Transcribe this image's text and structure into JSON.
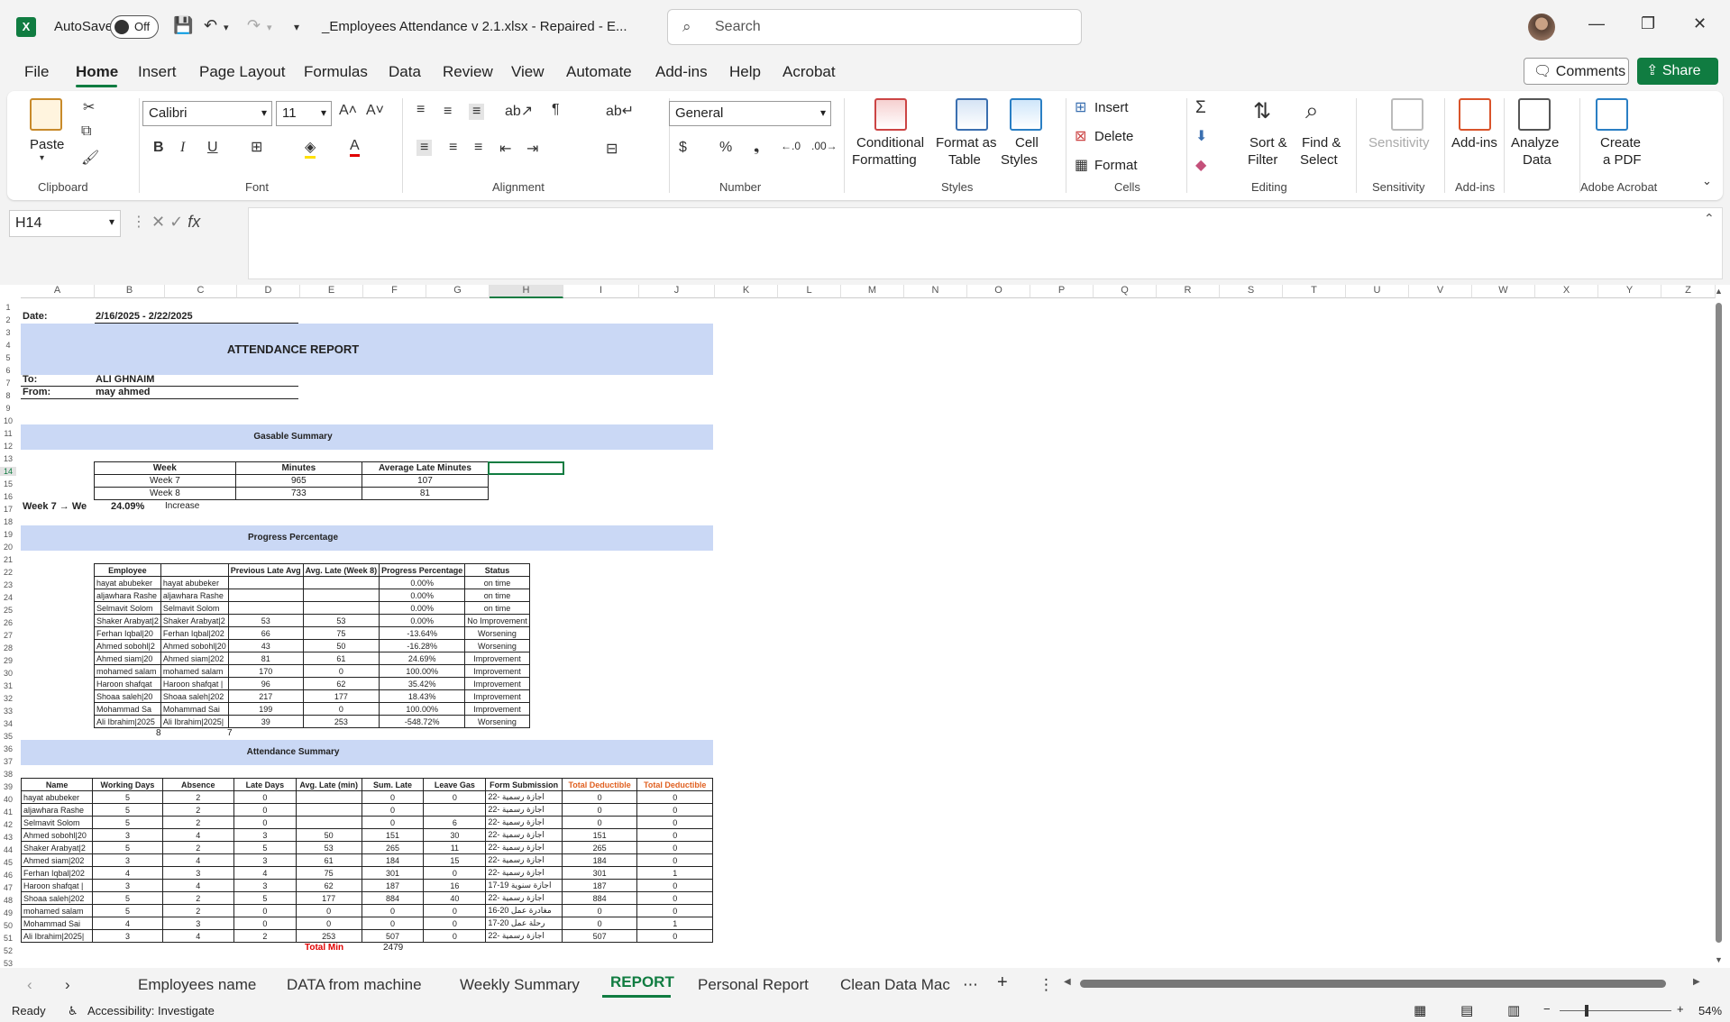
{
  "titlebar": {
    "autosave_label": "AutoSave",
    "autosave_state": "Off",
    "doc_title": "_Employees Attendance  v 2.1.xlsx  -  Repaired  -  E...",
    "search_placeholder": "Search"
  },
  "menu": {
    "items": [
      "File",
      "Home",
      "Insert",
      "Page Layout",
      "Formulas",
      "Data",
      "Review",
      "View",
      "Automate",
      "Add-ins",
      "Help",
      "Acrobat"
    ],
    "comments": "Comments",
    "share": "Share"
  },
  "ribbon": {
    "clipboard": {
      "paste": "Paste",
      "label": "Clipboard"
    },
    "font": {
      "name": "Calibri",
      "size": "11",
      "label": "Font"
    },
    "alignment": {
      "label": "Alignment"
    },
    "number": {
      "format": "General",
      "label": "Number"
    },
    "styles": {
      "cond1": "Conditional",
      "cond2": "Formatting",
      "fmt1": "Format as",
      "fmt2": "Table",
      "cell1": "Cell",
      "cell2": "Styles",
      "label": "Styles"
    },
    "cells": {
      "insert": "Insert",
      "delete": "Delete",
      "format": "Format",
      "label": "Cells"
    },
    "editing": {
      "sort1": "Sort &",
      "sort2": "Filter",
      "find1": "Find &",
      "find2": "Select",
      "label": "Editing"
    },
    "sensitivity": {
      "btn": "Sensitivity",
      "label": "Sensitivity"
    },
    "addins": {
      "btn": "Add-ins",
      "label": "Add-ins"
    },
    "analyze": {
      "l1": "Analyze",
      "l2": "Data"
    },
    "acrobat": {
      "l1": "Create",
      "l2": "a PDF",
      "label": "Adobe Acrobat"
    }
  },
  "formula": {
    "namebox": "H14",
    "content": ""
  },
  "columns": [
    "A",
    "B",
    "C",
    "D",
    "E",
    "F",
    "G",
    "H",
    "I",
    "J",
    "K",
    "L",
    "M",
    "N",
    "O",
    "P",
    "Q",
    "R",
    "S",
    "T",
    "U",
    "V",
    "W",
    "X",
    "Y",
    "Z"
  ],
  "report": {
    "date_label": "Date:",
    "date_value": "2/16/2025 - 2/22/2025",
    "title": "ATTENDANCE REPORT",
    "to_label": "To:",
    "to_value": "ALI GHNAIM",
    "from_label": "From:",
    "from_value": "may ahmed",
    "gasable_title": "Gasable Summary",
    "progress_title": "Progress Percentage",
    "attendance_title": "Attendance Summary",
    "week_compare_label": "Week 7 → We",
    "week_compare_value": "24.09%",
    "week_compare_note": "Increase",
    "progress_counts": [
      "8",
      "7"
    ],
    "total_label": "Total Min",
    "total_value": "2479"
  },
  "gasable": {
    "headers": [
      "Week",
      "Minutes",
      "Average Late Minutes"
    ],
    "rows": [
      [
        "Week 7",
        "965",
        "107"
      ],
      [
        "Week 8",
        "733",
        "81"
      ]
    ]
  },
  "progress": {
    "headers": [
      "Employee",
      "",
      "Previous Late Avg",
      "Avg. Late (Week 8)",
      "Progress Percentage",
      "Status"
    ],
    "rows": [
      [
        "hayat   abubeker",
        "hayat   abubeker",
        "",
        "",
        "0.00%",
        "on time"
      ],
      [
        "aljawhara Rashe",
        "aljawhara Rashe",
        "",
        "",
        "0.00%",
        "on time"
      ],
      [
        "Selmavit  Solom",
        "Selmavit  Solom",
        "",
        "",
        "0.00%",
        "on time"
      ],
      [
        "Shaker Arabyat|2",
        "Shaker Arabyat|2",
        "53",
        "53",
        "0.00%",
        "No Improvement"
      ],
      [
        "Ferhan Iqbal|20",
        "Ferhan Iqbal|202",
        "66",
        "75",
        "-13.64%",
        "Worsening"
      ],
      [
        "Ahmed sobohl|2",
        "Ahmed sobohl|20",
        "43",
        "50",
        "-16.28%",
        "Worsening"
      ],
      [
        "Ahmed siam|20",
        "Ahmed siam|202",
        "81",
        "61",
        "24.69%",
        "Improvement"
      ],
      [
        "mohamed salam",
        "mohamed salam",
        "170",
        "0",
        "100.00%",
        "Improvement"
      ],
      [
        "Haroon shafqat",
        "Haroon shafqat |",
        "96",
        "62",
        "35.42%",
        "Improvement"
      ],
      [
        "Shoaa saleh|20",
        "Shoaa saleh|202",
        "217",
        "177",
        "18.43%",
        "Improvement"
      ],
      [
        "Mohammad  Sa",
        "Mohammad  Sai",
        "199",
        "0",
        "100.00%",
        "Improvement"
      ],
      [
        "Ali Ibrahim|2025",
        "Ali Ibrahim|2025|",
        "39",
        "253",
        "-548.72%",
        "Worsening"
      ]
    ]
  },
  "attendance": {
    "headers": [
      "Name",
      "Working Days",
      "Absence",
      "Late Days",
      "Avg. Late (min)",
      "Sum. Late",
      "Leave Gas",
      "Form Submission",
      "Total Deductible",
      "Total Deductible"
    ],
    "rows": [
      [
        "hayat   abubeker",
        "5",
        "2",
        "0",
        "",
        "0",
        "0",
        "22- اجازة رسمية",
        "0",
        "0"
      ],
      [
        "aljawhara Rashe",
        "5",
        "2",
        "0",
        "",
        "0",
        "",
        "22- اجازة رسمية",
        "0",
        "0"
      ],
      [
        "Selmavit  Solom",
        "5",
        "2",
        "0",
        "",
        "0",
        "6",
        "22- اجازة رسمية",
        "0",
        "0"
      ],
      [
        "Ahmed sobohl|20",
        "3",
        "4",
        "3",
        "50",
        "151",
        "30",
        "22- اجازة رسمية",
        "151",
        "0"
      ],
      [
        "Shaker Arabyat|2",
        "5",
        "2",
        "5",
        "53",
        "265",
        "11",
        "22- اجازة رسمية",
        "265",
        "0"
      ],
      [
        "Ahmed siam|202",
        "3",
        "4",
        "3",
        "61",
        "184",
        "15",
        "22- اجازة رسمية",
        "184",
        "0"
      ],
      [
        "Ferhan Iqbal|202",
        "4",
        "3",
        "4",
        "75",
        "301",
        "0",
        "22- اجازة رسمية",
        "301",
        "1"
      ],
      [
        "Haroon shafqat |",
        "3",
        "4",
        "3",
        "62",
        "187",
        "16",
        "17-19 اجازة سنوية",
        "187",
        "0"
      ],
      [
        "Shoaa saleh|202",
        "5",
        "2",
        "5",
        "177",
        "884",
        "40",
        "22- اجازة رسمية",
        "884",
        "0"
      ],
      [
        "mohamed salam",
        "5",
        "2",
        "0",
        "0",
        "0",
        "0",
        "16-20 مغادرة عمل",
        "0",
        "0"
      ],
      [
        "Mohammad  Sai",
        "4",
        "3",
        "0",
        "0",
        "0",
        "0",
        "17-20 رحلة عمل",
        "0",
        "1"
      ],
      [
        "Ali Ibrahim|2025|",
        "3",
        "4",
        "2",
        "253",
        "507",
        "0",
        "22- اجازة رسمية",
        "507",
        "0"
      ]
    ]
  },
  "tabs": [
    "Employees name",
    "DATA from machine",
    "Weekly Summary",
    "REPORT",
    "Personal Report",
    "Clean Data Mac"
  ],
  "status": {
    "ready": "Ready",
    "accessibility": "Accessibility: Investigate",
    "zoom": "54%"
  },
  "colors": {
    "accent": "#107c41",
    "band": "#cad8f5",
    "deductible_header": "#e06020",
    "total_label": "#e00000"
  }
}
